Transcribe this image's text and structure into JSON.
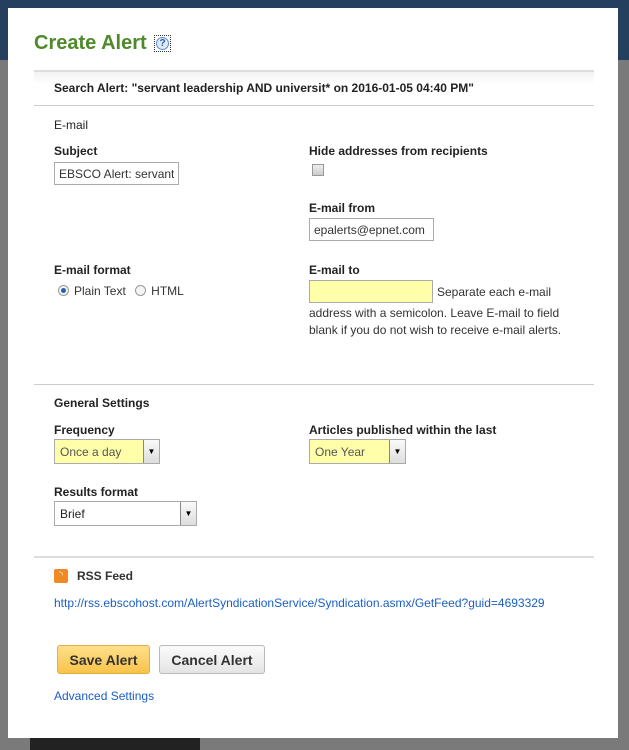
{
  "dialog": {
    "title": "Create Alert",
    "help_icon": "?",
    "search_alert": "Search Alert: \"servant leadership AND universit* on 2016-01-05 04:40 PM\""
  },
  "email": {
    "section": "E-mail",
    "subject_label": "Subject",
    "subject_value": "EBSCO Alert: servant l",
    "hide_label": "Hide addresses from recipients",
    "hide_checked": false,
    "from_label": "E-mail from",
    "from_value": "epalerts@epnet.com",
    "format_label": "E-mail format",
    "format_options": [
      "Plain Text",
      "HTML"
    ],
    "format_selected": "Plain Text",
    "to_label": "E-mail to",
    "to_value": "",
    "to_help_1": "Separate each e-mail",
    "to_help_2": "address with a semicolon. Leave E-mail to field blank if you do not wish to receive e-mail alerts."
  },
  "general": {
    "section": "General Settings",
    "frequency_label": "Frequency",
    "frequency_value": "Once a day",
    "articles_label": "Articles published within the last",
    "articles_value": "One Year",
    "results_label": "Results format",
    "results_value": "Brief"
  },
  "rss": {
    "label": "RSS Feed",
    "url": "http://rss.ebscohost.com/AlertSyndicationService/Syndication.asmx/GetFeed?guid=4693329"
  },
  "actions": {
    "save": "Save Alert",
    "cancel": "Cancel Alert",
    "advanced": "Advanced Settings"
  },
  "colors": {
    "title": "#4f8a2a",
    "link": "#1a5fc4",
    "save_button": "#f8c34a",
    "field_highlight": "#ffffaa"
  }
}
